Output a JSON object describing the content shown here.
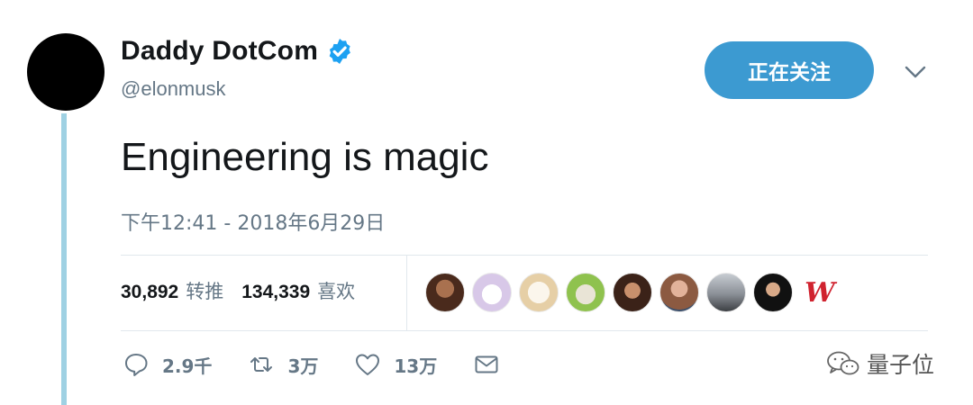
{
  "tweet": {
    "display_name": "Daddy DotCom",
    "handle": "@elonmusk",
    "follow_label": "正在关注",
    "text": "Engineering is magic",
    "timestamp": "下午12:41 - 2018年6月29日"
  },
  "stats": {
    "retweets": {
      "count": "30,892",
      "label": "转推"
    },
    "likes": {
      "count": "134,339",
      "label": "喜欢"
    }
  },
  "likers_initial": "W",
  "actions": {
    "reply_count": "2.9千",
    "retweet_count": "3万",
    "like_count": "13万"
  },
  "watermark": {
    "text": "量子位"
  },
  "colors": {
    "follow_button": "#3c9ad1",
    "verified_badge": "#1da1f2",
    "thread_line": "#9fd1e3",
    "muted_text": "#657786"
  },
  "icons": [
    "verified-badge-icon",
    "chevron-down-icon",
    "reply-icon",
    "retweet-icon",
    "like-icon",
    "direct-message-icon",
    "wechat-icon"
  ]
}
